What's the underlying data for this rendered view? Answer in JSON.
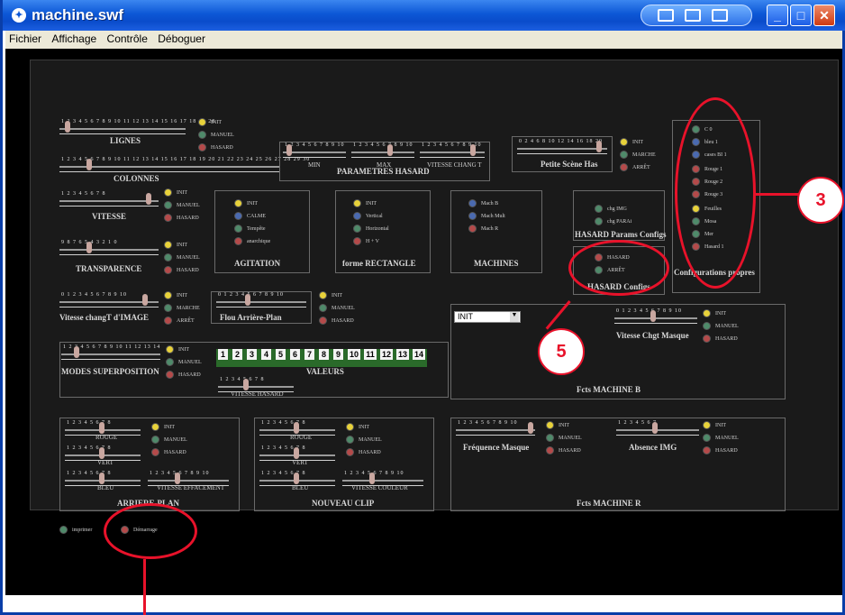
{
  "window": {
    "title": "machine.swf",
    "controls": [
      "minimize",
      "maximize",
      "close"
    ]
  },
  "menu": [
    "Fichier",
    "Affichage",
    "Contrôle",
    "Déboguer"
  ],
  "lignes": {
    "label": "LIGNES",
    "ticks": "1 2 3 4 5 6 7 8 9 10 11 12 13 14 15 16 17 18 19 20",
    "options": [
      "INIT",
      "MANUEL",
      "HASARD"
    ]
  },
  "colonnes": {
    "label": "COLONNES",
    "ticks": "1 2 3 4 5 6 7 8 9 10 11 12 13 14 15 16 17 18 19 20 21 22 23 24 25 26 27 28 29 30"
  },
  "parametres": {
    "label": "PARAMETRES HASARD",
    "sliders": [
      "MIN",
      "MAX",
      "VITESSE CHANG T"
    ]
  },
  "petite": {
    "label": "Petite Scène Has",
    "ticks": "0 2 4 6 8 10 12 14 16 18 20",
    "options": [
      "INIT",
      "MARCHE",
      "ARRÊT"
    ]
  },
  "vitesse": {
    "label": "VITESSE",
    "ticks": "1 2 3 4 5 6 7 8",
    "options": [
      "INIT",
      "MANUEL",
      "HASARD"
    ]
  },
  "agitation": {
    "label": "AGITATION",
    "options": [
      "INIT",
      "CALME",
      "Tempête",
      "anarchique"
    ]
  },
  "forme": {
    "label": "forme RECTANGLE",
    "options": [
      "INIT",
      "Vertical",
      "Horizontal",
      "H + V"
    ]
  },
  "machines": {
    "label": "MACHINES",
    "options": [
      "Mach B",
      "Mach Mult",
      "Mach R"
    ]
  },
  "hasard_params": {
    "label": "HASARD Params Configs",
    "options": [
      "chg IMG",
      "chg PARAi"
    ]
  },
  "hasard_configs": {
    "label": "HASARD Configs",
    "options": [
      "HASARD",
      "ARRÊT"
    ]
  },
  "configs_propres": {
    "label": "Configurations propres",
    "options": [
      "C 0",
      "bleu 1",
      "cases BI 1",
      "Rouge 1",
      "Rouge 2",
      "Rouge 3",
      "Feuilles",
      "Mosa",
      "Mer",
      "Hasard 1"
    ]
  },
  "transparence": {
    "label": "TRANSPARENCE",
    "ticks": "9 8 7 6 5 4 3 2 1 0",
    "options": [
      "INIT",
      "MANUEL",
      "HASARD"
    ]
  },
  "vitesse_image": {
    "label": "Vitesse changT d'IMAGE",
    "ticks": "0 1 2 3 4 5 6 7 8 9 10",
    "options": [
      "INIT",
      "MARCHE",
      "ARRÊT"
    ]
  },
  "flou": {
    "label": "Flou Arrière-Plan",
    "ticks": "0 1 2 3 4 5 6 7 8 9 10",
    "options": [
      "INIT",
      "MANUEL",
      "HASARD"
    ]
  },
  "modes": {
    "label": "MODES SUPERPOSITION",
    "ticks": "1 2 3 4 5 6 7 8 9 10 11 12 13 14",
    "options": [
      "INIT",
      "MANUEL",
      "HASARD"
    ]
  },
  "valeurs": {
    "label": "VALEURS",
    "numbers": [
      "1",
      "2",
      "3",
      "4",
      "5",
      "6",
      "7",
      "8",
      "9",
      "10",
      "11",
      "12",
      "13",
      "14"
    ],
    "sub_label": "VITESSE HASARD"
  },
  "machine_b": {
    "label": "Fcts MACHINE B",
    "select_value": "INIT",
    "masque_label": "Vitesse Chgt Masque",
    "masque_ticks": "0 1 2 3 4 5 6 7 8 9 10",
    "options": [
      "INIT",
      "MANUEL",
      "HASARD"
    ]
  },
  "arriere_plan": {
    "label": "ARRIERE-PLAN",
    "sliders": [
      "ROUGE",
      "VERT",
      "BLEU",
      "VITESSE EFFACEMENT"
    ],
    "options": [
      "INIT",
      "MANUEL",
      "HASARD"
    ]
  },
  "nouveau_clip": {
    "label": "NOUVEAU CLIP",
    "sliders": [
      "ROUGE",
      "VERT",
      "BLEU",
      "VITESSE COULEUR"
    ],
    "options": [
      "INIT",
      "MANUEL",
      "HASARD"
    ]
  },
  "machine_r": {
    "label": "Fcts MACHINE R",
    "frequence_label": "Fréquence Masque",
    "frequence_ticks": "1 2 3 4 5 6 7 8 9 10",
    "absence_label": "Absence IMG",
    "absence_ticks": "1 2 3 4 5 6 7",
    "options": [
      "INIT",
      "MANUEL",
      "HASARD"
    ]
  },
  "bottom": {
    "options": [
      "imprimer",
      "Démarrage"
    ]
  },
  "annotations": {
    "three": "3",
    "five": "5"
  },
  "colors": {
    "titlebar": "#0c57d6",
    "annotation": "#e8122a",
    "panel": "#1a1a1a"
  }
}
